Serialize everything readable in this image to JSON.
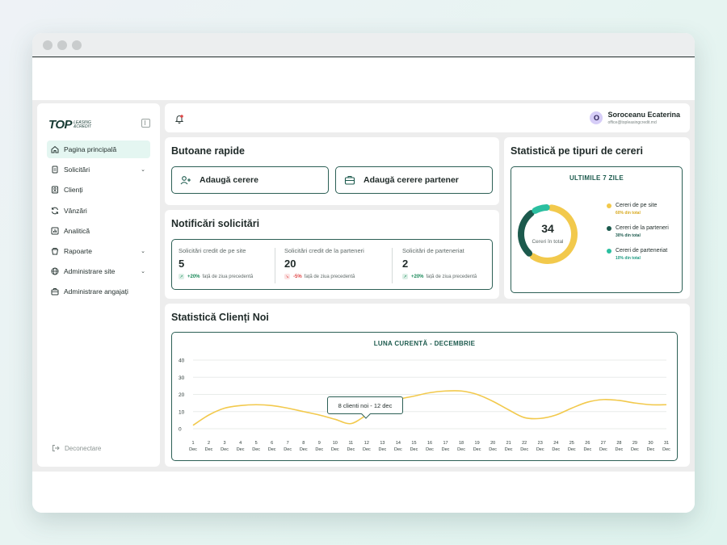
{
  "brand": {
    "logo_main": "TOP",
    "logo_sub_1": "LEASING",
    "logo_sub_2": "&CREDIT"
  },
  "sidebar": {
    "items": [
      {
        "label": "Pagina principală",
        "icon": "home-icon",
        "active": true
      },
      {
        "label": "Solicitări",
        "icon": "file-icon",
        "has_children": true
      },
      {
        "label": "Clienți",
        "icon": "clients-icon"
      },
      {
        "label": "Vânzări",
        "icon": "refresh-icon"
      },
      {
        "label": "Analitică",
        "icon": "analytics-icon"
      },
      {
        "label": "Rapoarte",
        "icon": "reports-icon",
        "has_children": true
      },
      {
        "label": "Administrare site",
        "icon": "globe-icon",
        "has_children": true
      },
      {
        "label": "Administrare angajați",
        "icon": "briefcase-icon"
      }
    ],
    "logout_label": "Deconectare"
  },
  "header": {
    "user_initial": "O",
    "user_name": "Soroceanu Ecaterina",
    "user_email": "office@topleasingcredit.md"
  },
  "quick": {
    "title": "Butoane rapide",
    "add_request": "Adaugă cerere",
    "add_partner_request": "Adaugă cerere partener"
  },
  "notifications": {
    "title": "Notificări solicitări",
    "cards": [
      {
        "label": "Solicitări credit de pe site",
        "value": "5",
        "pct": "+20%",
        "trend": "față de ziua precedentă",
        "direction": "up"
      },
      {
        "label": "Solicitări credit de la parteneri",
        "value": "20",
        "pct": "-5%",
        "trend": "față de ziua precedentă",
        "direction": "down"
      },
      {
        "label": "Solicitări de parteneriat",
        "value": "2",
        "pct": "+20%",
        "trend": "față de ziua precedentă",
        "direction": "up"
      }
    ]
  },
  "types": {
    "title": "Statistică pe tipuri de cereri",
    "period": "ULTIMILE 7 ZILE",
    "total": "34",
    "total_caption": "Cereri în total",
    "legend": [
      {
        "label": "Cereri de pe site",
        "pct": "60% din total",
        "value": 60,
        "color": "#f2c94c"
      },
      {
        "label": "Cereri de la parteneri",
        "pct": "30% din total",
        "value": 30,
        "color": "#1c5a4d"
      },
      {
        "label": "Cereri de parteneriat",
        "pct": "10% din total",
        "value": 10,
        "color": "#2bbfa0"
      }
    ]
  },
  "clients": {
    "title": "Statistică Clienți Noi",
    "period": "LUNA CURENTĂ - DECEMBRIE",
    "tooltip": "8 clienti noi - 12 dec"
  },
  "colors": {
    "accent": "#1c5a4d",
    "yellow": "#f2c94c",
    "teal": "#2bbfa0",
    "up": "#1c8a5a",
    "down": "#e04848"
  },
  "chart_data": {
    "type": "line",
    "title": "LUNA CURENTĂ - DECEMBRIE",
    "x_day": [
      "1",
      "2",
      "3",
      "4",
      "5",
      "6",
      "7",
      "8",
      "9",
      "10",
      "11",
      "12",
      "13",
      "14",
      "15",
      "16",
      "17",
      "18",
      "19",
      "20",
      "21",
      "22",
      "23",
      "24",
      "25",
      "26",
      "27",
      "28",
      "29",
      "30",
      "31"
    ],
    "x_month": "Dec",
    "ylim": [
      0,
      40
    ],
    "yticks": [
      0,
      10,
      20,
      30,
      40
    ],
    "series": [
      {
        "values": [
          2,
          8,
          12,
          13.5,
          14,
          13.5,
          12,
          10,
          8,
          5.5,
          3,
          8,
          13,
          17,
          19,
          21,
          22,
          22,
          20,
          16,
          11,
          6.5,
          6,
          8,
          12,
          15.5,
          17,
          16.5,
          15,
          14,
          14
        ],
        "color": "#f2c94c"
      }
    ],
    "grid": true
  }
}
